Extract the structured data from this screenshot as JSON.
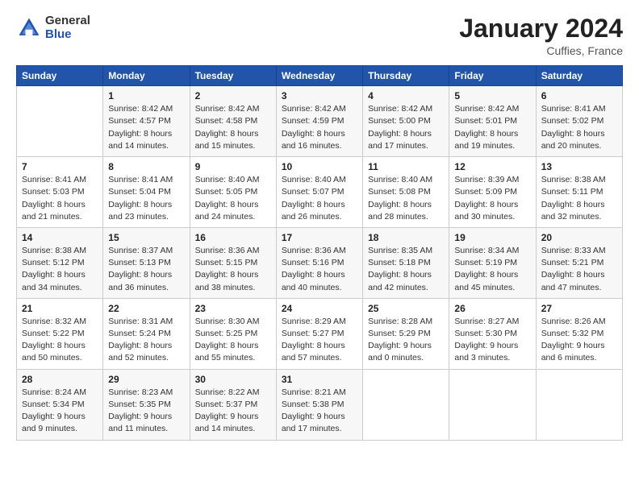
{
  "header": {
    "logo_general": "General",
    "logo_blue": "Blue",
    "month_year": "January 2024",
    "location": "Cuffies, France"
  },
  "days_of_week": [
    "Sunday",
    "Monday",
    "Tuesday",
    "Wednesday",
    "Thursday",
    "Friday",
    "Saturday"
  ],
  "weeks": [
    [
      {
        "day": "",
        "info": ""
      },
      {
        "day": "1",
        "info": "Sunrise: 8:42 AM\nSunset: 4:57 PM\nDaylight: 8 hours\nand 14 minutes."
      },
      {
        "day": "2",
        "info": "Sunrise: 8:42 AM\nSunset: 4:58 PM\nDaylight: 8 hours\nand 15 minutes."
      },
      {
        "day": "3",
        "info": "Sunrise: 8:42 AM\nSunset: 4:59 PM\nDaylight: 8 hours\nand 16 minutes."
      },
      {
        "day": "4",
        "info": "Sunrise: 8:42 AM\nSunset: 5:00 PM\nDaylight: 8 hours\nand 17 minutes."
      },
      {
        "day": "5",
        "info": "Sunrise: 8:42 AM\nSunset: 5:01 PM\nDaylight: 8 hours\nand 19 minutes."
      },
      {
        "day": "6",
        "info": "Sunrise: 8:41 AM\nSunset: 5:02 PM\nDaylight: 8 hours\nand 20 minutes."
      }
    ],
    [
      {
        "day": "7",
        "info": "Sunrise: 8:41 AM\nSunset: 5:03 PM\nDaylight: 8 hours\nand 21 minutes."
      },
      {
        "day": "8",
        "info": "Sunrise: 8:41 AM\nSunset: 5:04 PM\nDaylight: 8 hours\nand 23 minutes."
      },
      {
        "day": "9",
        "info": "Sunrise: 8:40 AM\nSunset: 5:05 PM\nDaylight: 8 hours\nand 24 minutes."
      },
      {
        "day": "10",
        "info": "Sunrise: 8:40 AM\nSunset: 5:07 PM\nDaylight: 8 hours\nand 26 minutes."
      },
      {
        "day": "11",
        "info": "Sunrise: 8:40 AM\nSunset: 5:08 PM\nDaylight: 8 hours\nand 28 minutes."
      },
      {
        "day": "12",
        "info": "Sunrise: 8:39 AM\nSunset: 5:09 PM\nDaylight: 8 hours\nand 30 minutes."
      },
      {
        "day": "13",
        "info": "Sunrise: 8:38 AM\nSunset: 5:11 PM\nDaylight: 8 hours\nand 32 minutes."
      }
    ],
    [
      {
        "day": "14",
        "info": "Sunrise: 8:38 AM\nSunset: 5:12 PM\nDaylight: 8 hours\nand 34 minutes."
      },
      {
        "day": "15",
        "info": "Sunrise: 8:37 AM\nSunset: 5:13 PM\nDaylight: 8 hours\nand 36 minutes."
      },
      {
        "day": "16",
        "info": "Sunrise: 8:36 AM\nSunset: 5:15 PM\nDaylight: 8 hours\nand 38 minutes."
      },
      {
        "day": "17",
        "info": "Sunrise: 8:36 AM\nSunset: 5:16 PM\nDaylight: 8 hours\nand 40 minutes."
      },
      {
        "day": "18",
        "info": "Sunrise: 8:35 AM\nSunset: 5:18 PM\nDaylight: 8 hours\nand 42 minutes."
      },
      {
        "day": "19",
        "info": "Sunrise: 8:34 AM\nSunset: 5:19 PM\nDaylight: 8 hours\nand 45 minutes."
      },
      {
        "day": "20",
        "info": "Sunrise: 8:33 AM\nSunset: 5:21 PM\nDaylight: 8 hours\nand 47 minutes."
      }
    ],
    [
      {
        "day": "21",
        "info": "Sunrise: 8:32 AM\nSunset: 5:22 PM\nDaylight: 8 hours\nand 50 minutes."
      },
      {
        "day": "22",
        "info": "Sunrise: 8:31 AM\nSunset: 5:24 PM\nDaylight: 8 hours\nand 52 minutes."
      },
      {
        "day": "23",
        "info": "Sunrise: 8:30 AM\nSunset: 5:25 PM\nDaylight: 8 hours\nand 55 minutes."
      },
      {
        "day": "24",
        "info": "Sunrise: 8:29 AM\nSunset: 5:27 PM\nDaylight: 8 hours\nand 57 minutes."
      },
      {
        "day": "25",
        "info": "Sunrise: 8:28 AM\nSunset: 5:29 PM\nDaylight: 9 hours\nand 0 minutes."
      },
      {
        "day": "26",
        "info": "Sunrise: 8:27 AM\nSunset: 5:30 PM\nDaylight: 9 hours\nand 3 minutes."
      },
      {
        "day": "27",
        "info": "Sunrise: 8:26 AM\nSunset: 5:32 PM\nDaylight: 9 hours\nand 6 minutes."
      }
    ],
    [
      {
        "day": "28",
        "info": "Sunrise: 8:24 AM\nSunset: 5:34 PM\nDaylight: 9 hours\nand 9 minutes."
      },
      {
        "day": "29",
        "info": "Sunrise: 8:23 AM\nSunset: 5:35 PM\nDaylight: 9 hours\nand 11 minutes."
      },
      {
        "day": "30",
        "info": "Sunrise: 8:22 AM\nSunset: 5:37 PM\nDaylight: 9 hours\nand 14 minutes."
      },
      {
        "day": "31",
        "info": "Sunrise: 8:21 AM\nSunset: 5:38 PM\nDaylight: 9 hours\nand 17 minutes."
      },
      {
        "day": "",
        "info": ""
      },
      {
        "day": "",
        "info": ""
      },
      {
        "day": "",
        "info": ""
      }
    ]
  ]
}
